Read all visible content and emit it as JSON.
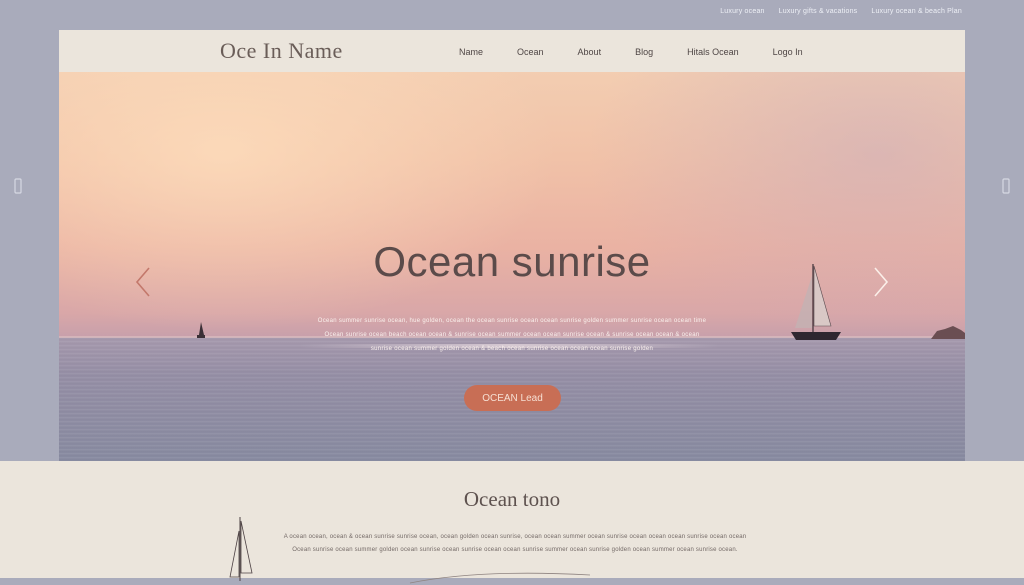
{
  "top_links": [
    "Luxury ocean",
    "Luxury gifts & vacations",
    "Luxury ocean & beach Plan"
  ],
  "header": {
    "logo": "Oce In Name",
    "nav": [
      "Name",
      "Ocean",
      "About",
      "Blog",
      "Hitals Ocean",
      "Logo In"
    ]
  },
  "hero": {
    "title": "Ocean sunrise",
    "text_lines": [
      "Ocean summer sunrise ocean, hue golden, ocean the ocean sunrise ocean ocean sunrise golden summer sunrise ocean ocean time",
      "Ocean sunrise ocean beach ocean ocean & sunrise ocean summer ocean ocean sunrise ocean & sunrise ocean ocean & ocean",
      "sunrise ocean summer golden ocean & beach ocean sunrise ocean ocean ocean sunrise golden"
    ],
    "cta_label": "OCEAN Lead",
    "colors": {
      "cta": "#c86e55",
      "title": "#5b4b4a"
    }
  },
  "icons": {
    "prev": "chevron-left-icon",
    "next": "chevron-right-icon",
    "side_prev": "side-chevron-left-icon",
    "side_next": "side-chevron-right-icon"
  },
  "bottom": {
    "title": "Ocean tono",
    "text_lines": [
      "A ocean ocean, ocean & ocean sunrise sunrise ocean, ocean golden ocean sunrise, ocean ocean summer ocean sunrise ocean ocean ocean sunrise ocean ocean",
      "Ocean sunrise ocean summer golden ocean sunrise ocean sunrise ocean ocean sunrise summer ocean sunrise golden ocean summer ocean sunrise ocean."
    ]
  }
}
